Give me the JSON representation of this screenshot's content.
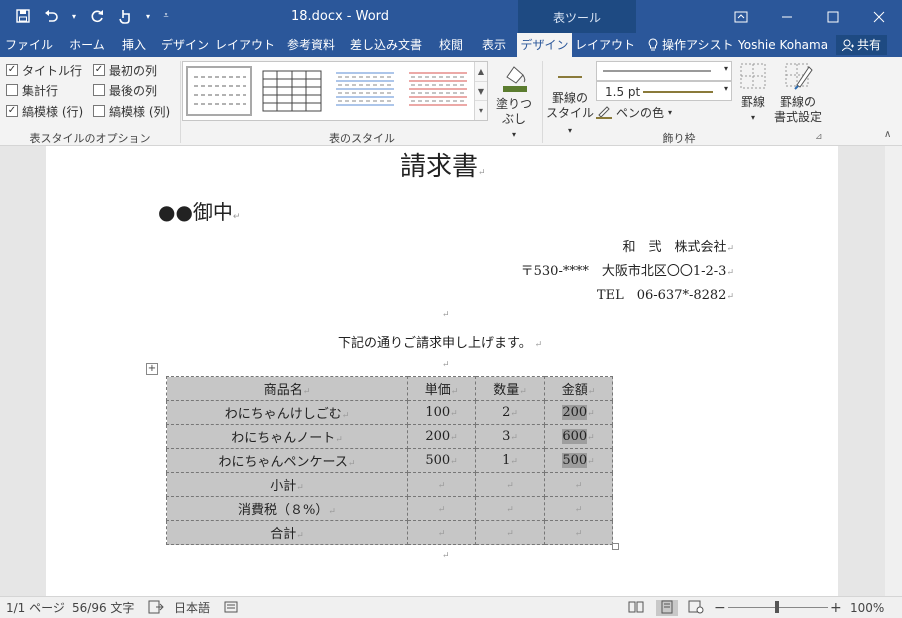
{
  "titlebar": {
    "doc_title": "18.docx - Word",
    "table_tools": "表ツール"
  },
  "tabs": [
    {
      "label": "ファイル"
    },
    {
      "label": "ホーム"
    },
    {
      "label": "挿入"
    },
    {
      "label": "デザイン"
    },
    {
      "label": "レイアウト"
    },
    {
      "label": "参考資料"
    },
    {
      "label": "差し込み文書"
    },
    {
      "label": "校閲"
    },
    {
      "label": "表示"
    },
    {
      "label": "デザイン"
    },
    {
      "label": "レイアウト"
    }
  ],
  "tell_me": "操作アシスト",
  "user_name": "Yoshie Kohama",
  "share": "共有",
  "ribbon": {
    "options": {
      "header_row": "タイトル行",
      "total_row": "集計行",
      "banded_rows": "縞模様 (行)",
      "first_column": "最初の列",
      "last_column": "最後の列",
      "banded_columns": "縞模様 (列)",
      "group_label": "表スタイルのオプション"
    },
    "styles": {
      "group_label": "表のスタイル",
      "shading": "塗りつぶし"
    },
    "borders": {
      "border_style_1": "罫線の",
      "border_style_2": "スタイル",
      "line_weight": "1.5 pt",
      "pen_color": "ペンの色",
      "borders": "罫線",
      "painter_1": "罫線の",
      "painter_2": "書式設定",
      "group_label": "飾り枠"
    }
  },
  "document": {
    "title": "請求書",
    "recipient": "●●御中",
    "company": "和　弐　株式会社",
    "address": "〒530-****　大阪市北区〇〇1-2-3",
    "tel": "TEL　06-637*-8282",
    "greeting": "下記の通りご請求申し上げます。",
    "table": {
      "headers": [
        "商品名",
        "単価",
        "数量",
        "金額"
      ],
      "rows": [
        [
          "わにちゃんけしごむ",
          "100",
          "2",
          "200"
        ],
        [
          "わにちゃんノート",
          "200",
          "3",
          "600"
        ],
        [
          "わにちゃんペンケース",
          "500",
          "1",
          "500"
        ],
        [
          "小計",
          "",
          "",
          ""
        ],
        [
          "消費税（８%）",
          "",
          "",
          ""
        ],
        [
          "合計",
          "",
          "",
          ""
        ]
      ]
    }
  },
  "status": {
    "page": "1/1 ページ",
    "words": "56/96 文字",
    "language": "日本語",
    "zoom": "100%"
  }
}
